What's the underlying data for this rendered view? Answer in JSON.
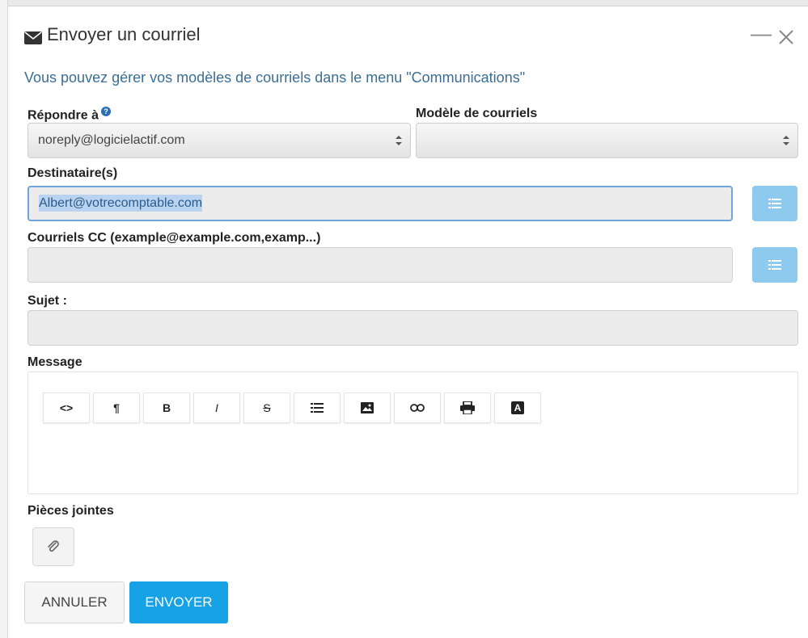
{
  "dialog": {
    "title": "Envoyer un courriel",
    "icon": "envelope-icon",
    "controls": {
      "minimize": "—",
      "close": "✕"
    }
  },
  "info": "Vous pouvez gérer vos modèles de courriels dans le menu \"Communications\"",
  "reply_to": {
    "label": "Répondre à",
    "help_icon": "?",
    "value": "noreply@logicielactif.com"
  },
  "template": {
    "label": "Modèle de courriels",
    "value": ""
  },
  "recipients": {
    "label": "Destinataire(s)",
    "value": "Albert@votrecomptable.com"
  },
  "cc": {
    "label": "Courriels CC (example@example.com,examp...)",
    "value": ""
  },
  "subject": {
    "label": "Sujet :",
    "value": ""
  },
  "message": {
    "label": "Message",
    "toolbar": [
      {
        "name": "code-view",
        "glyph": "<>"
      },
      {
        "name": "paragraph",
        "glyph": "¶"
      },
      {
        "name": "bold",
        "glyph": "B"
      },
      {
        "name": "italic",
        "glyph": "I"
      },
      {
        "name": "strikethrough",
        "glyph": "S"
      },
      {
        "name": "list",
        "glyph": "≡"
      },
      {
        "name": "image",
        "glyph": ""
      },
      {
        "name": "link",
        "glyph": "⊂⊃"
      },
      {
        "name": "print",
        "glyph": ""
      },
      {
        "name": "font-color",
        "glyph": "A"
      }
    ]
  },
  "attachments": {
    "label": "Pièces jointes"
  },
  "actions": {
    "cancel": "ANNULER",
    "send": "ENVOYER"
  },
  "colors": {
    "info_text": "#3a6e93",
    "send_button": "#17a2e6",
    "list_button": "#8ec9ee",
    "focus_border": "#6fa6db"
  }
}
